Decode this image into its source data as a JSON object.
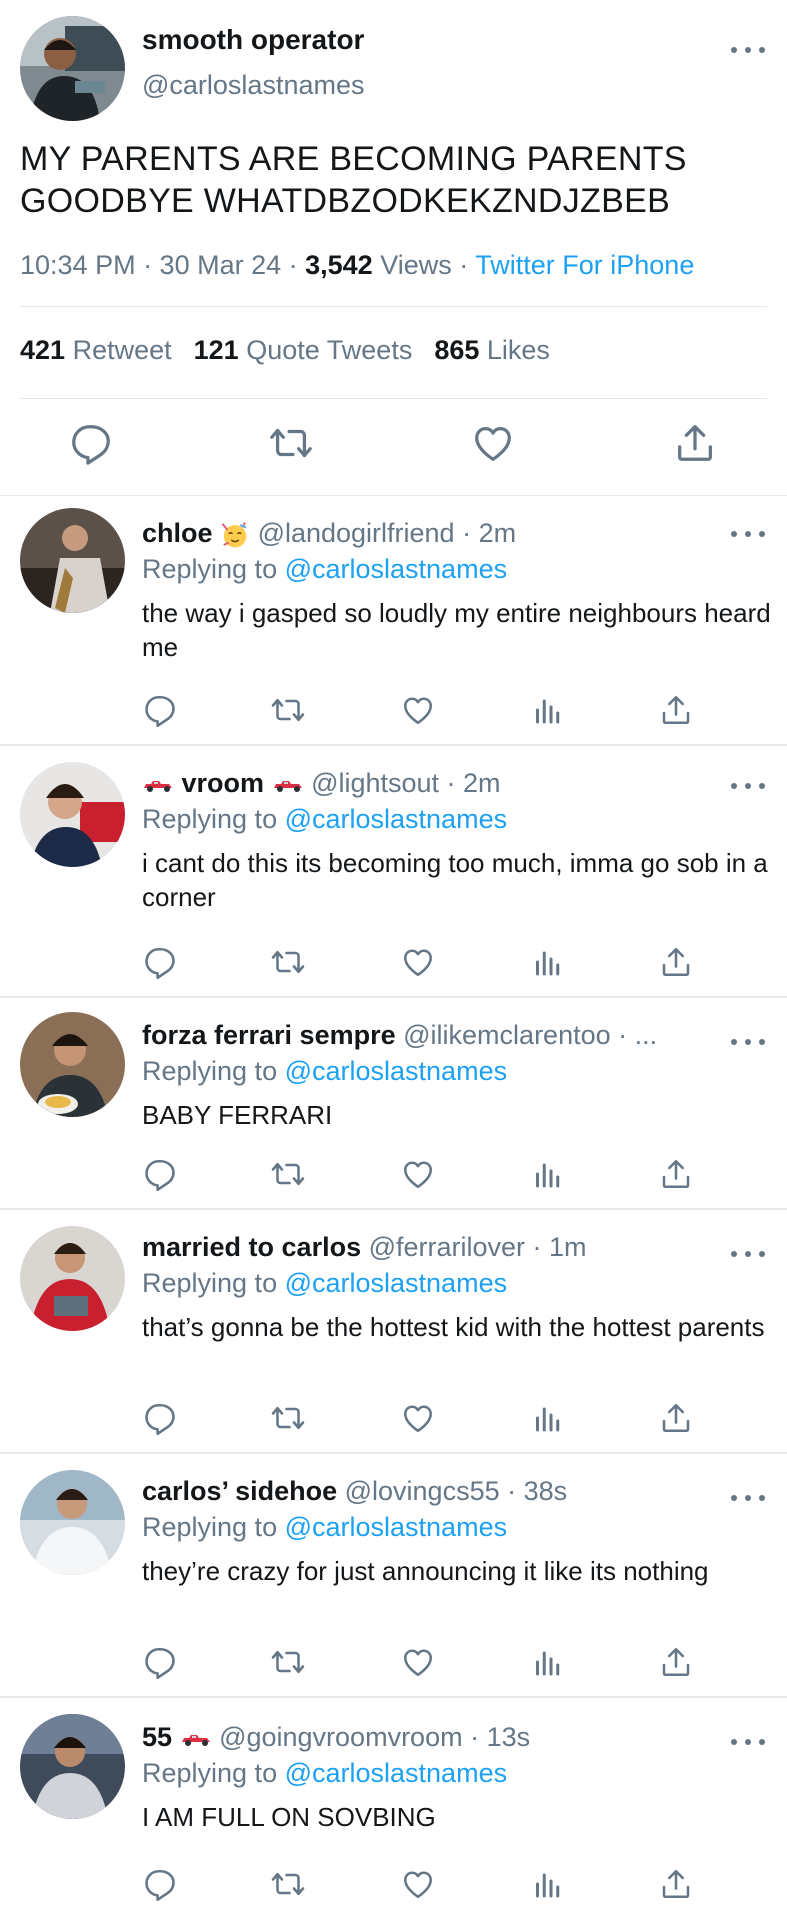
{
  "main_tweet": {
    "display_name": "smooth operator",
    "handle": "@carloslastnames",
    "text": "MY PARENTS ARE BECOMING PARENTS GOODBYE WHATDBZODKEKZNDJZBEB",
    "time": "10:34 PM · 30 Mar 24 · ",
    "views_count": "3,542",
    "views_label": " Views · ",
    "source": "Twitter For iPhone",
    "retweets_count": "421",
    "retweets_label": "Retweet",
    "quotes_count": "121",
    "quotes_label": "Quote Tweets",
    "likes_count": "865",
    "likes_label": "Likes"
  },
  "replies": [
    {
      "name": "chloe",
      "emoji": "partying-face",
      "handle": "@landogirlfriend · 2m",
      "replying_label": "Replying to ",
      "replying_to": "@carloslastnames",
      "text": "the way i gasped so loudly my entire neighbours heard me"
    },
    {
      "name": "vroom",
      "emoji": "race-car",
      "handle": "@lightsout · 2m",
      "replying_label": "Replying to ",
      "replying_to": "@carloslastnames",
      "text": "i cant do this its becoming too much, imma go sob in a corner"
    },
    {
      "name": "forza ferrari sempre",
      "handle": "@ilikemclarentoo · ...",
      "replying_label": "Replying to ",
      "replying_to": "@carloslastnames",
      "text": "BABY FERRARI"
    },
    {
      "name": "married to carlos",
      "handle": "@ferrarilover · 1m",
      "replying_label": "Replying to ",
      "replying_to": "@carloslastnames",
      "text": "that’s gonna be the hottest kid with the hottest parents"
    },
    {
      "name": "carlos’ sidehoe",
      "handle": "@lovingcs55 · 38s",
      "replying_label": "Replying to ",
      "replying_to": "@carloslastnames",
      "text": "they’re crazy for just announcing it like its nothing"
    },
    {
      "name": "55",
      "emoji": "race-car",
      "handle": "@goingvroomvroom · 13s",
      "replying_label": "Replying to ",
      "replying_to": "@carloslastnames",
      "text": "I AM FULL ON SOVBING"
    }
  ],
  "colors": {
    "link": "#1da1f2",
    "secondary_text": "#657786",
    "primary_text": "#14171a",
    "divider": "#e4e8eb"
  },
  "icons": [
    "reply-icon",
    "retweet-icon",
    "like-icon",
    "analytics-icon",
    "share-icon",
    "more-icon"
  ]
}
